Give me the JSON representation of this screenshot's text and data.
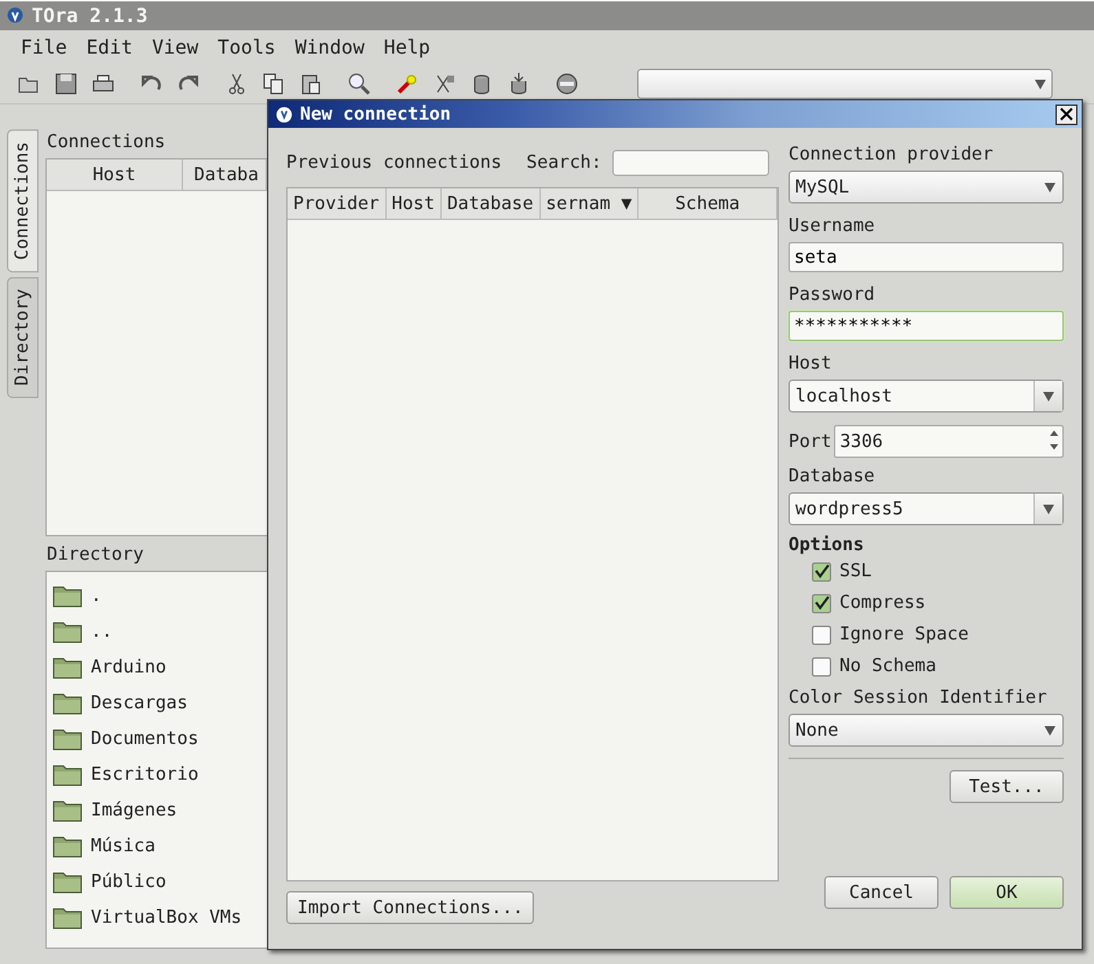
{
  "window": {
    "title": "TOra 2.1.3"
  },
  "menu": [
    "File",
    "Edit",
    "View",
    "Tools",
    "Window",
    "Help"
  ],
  "side_tabs": [
    {
      "label": "Connections",
      "selected": true
    },
    {
      "label": "Directory",
      "selected": false
    }
  ],
  "connections_panel": {
    "title": "Connections",
    "columns": [
      "Host",
      "Databa"
    ]
  },
  "directory_panel": {
    "title": "Directory",
    "items": [
      ".",
      "..",
      "Arduino",
      "Descargas",
      "Documentos",
      "Escritorio",
      "Imágenes",
      "Música",
      "Público",
      "VirtualBox VMs"
    ]
  },
  "dialog": {
    "title": "New connection",
    "previous_label": "Previous connections",
    "search_label": "Search:",
    "columns": [
      "Provider",
      "Host",
      "Database",
      "sernam ▼",
      "Schema"
    ],
    "import_button": "Import Connections...",
    "provider": {
      "label": "Connection provider",
      "value": "MySQL"
    },
    "username": {
      "label": "Username",
      "value": "seta"
    },
    "password": {
      "label": "Password",
      "value": "***********"
    },
    "host": {
      "label": "Host",
      "value": "localhost"
    },
    "port": {
      "label": "Port",
      "value": "3306"
    },
    "database": {
      "label": "Database",
      "value": "wordpress5"
    },
    "options_label": "Options",
    "options": [
      {
        "label": "SSL",
        "checked": true
      },
      {
        "label": "Compress",
        "checked": true
      },
      {
        "label": "Ignore Space",
        "checked": false
      },
      {
        "label": "No Schema",
        "checked": false
      }
    ],
    "color_session": {
      "label": "Color Session Identifier",
      "value": "None"
    },
    "test_button": "Test...",
    "buttons": [
      {
        "label": "Cancel",
        "default": false
      },
      {
        "label": "OK",
        "default": true
      }
    ]
  }
}
